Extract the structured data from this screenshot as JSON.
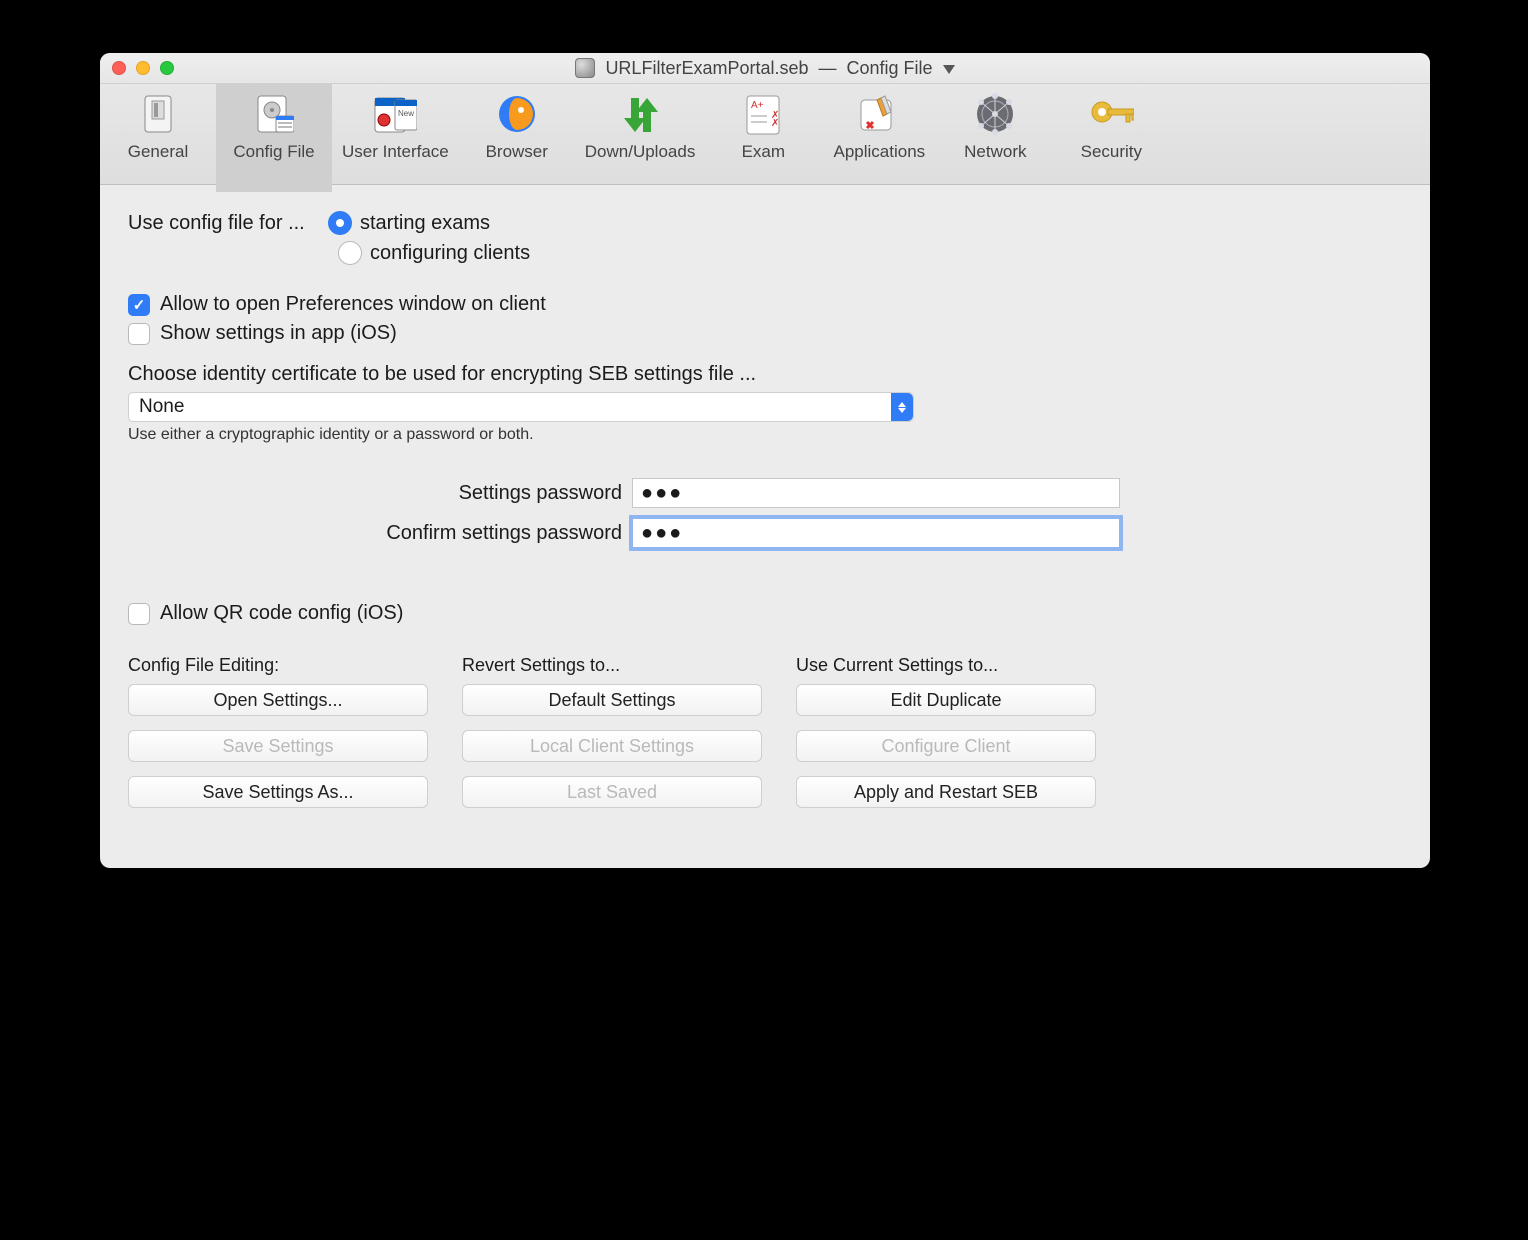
{
  "window": {
    "title_filename": "URLFilterExamPortal.seb",
    "title_section": "Config File"
  },
  "toolbar": {
    "general": "General",
    "config_file": "Config File",
    "user_interface": "User Interface",
    "browser": "Browser",
    "down_uploads": "Down/Uploads",
    "exam": "Exam",
    "applications": "Applications",
    "network": "Network",
    "security": "Security"
  },
  "use_config": {
    "lead": "Use config file for ...",
    "opt_start": "starting exams",
    "opt_configure": "configuring clients",
    "selected": "starting exams"
  },
  "checkboxes": {
    "allow_preferences": {
      "label": "Allow to open Preferences window on client",
      "checked": true
    },
    "show_settings_ios": {
      "label": "Show settings in app (iOS)",
      "checked": false
    },
    "allow_qr": {
      "label": "Allow QR code config (iOS)",
      "checked": false
    }
  },
  "identity": {
    "heading": "Choose identity certificate to be used for encrypting SEB settings file ...",
    "selected": "None",
    "help": "Use either a cryptographic identity or a password or both."
  },
  "passwords": {
    "settings_label": "Settings password",
    "confirm_label": "Confirm settings password",
    "settings_value": "●●●",
    "confirm_value": "●●●"
  },
  "groups": {
    "config_file_editing": {
      "title": "Config File Editing:",
      "open_settings": "Open Settings...",
      "save_settings": "Save Settings",
      "save_settings_as": "Save Settings As..."
    },
    "revert": {
      "title": "Revert Settings to...",
      "default": "Default Settings",
      "local_client": "Local Client Settings",
      "last_saved": "Last Saved"
    },
    "use_current": {
      "title": "Use Current Settings to...",
      "edit_duplicate": "Edit Duplicate",
      "configure_client": "Configure Client",
      "apply_restart": "Apply and Restart SEB"
    }
  }
}
